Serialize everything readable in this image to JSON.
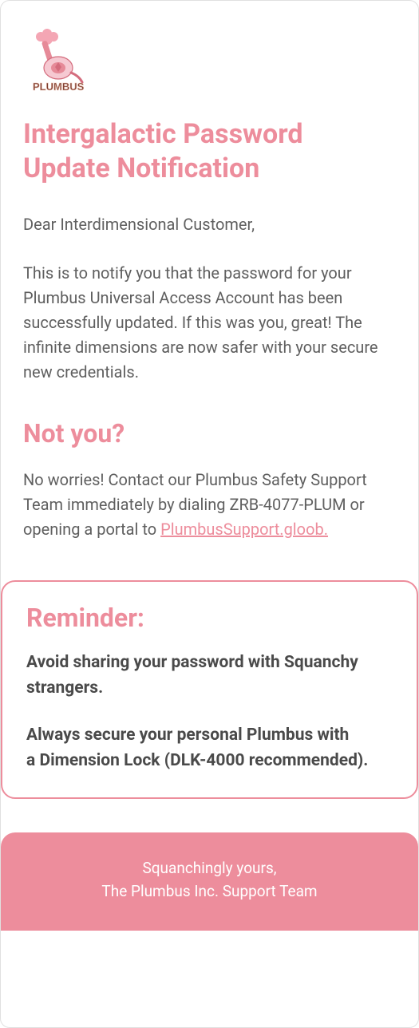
{
  "logo": {
    "text": "PLUMBUS"
  },
  "title": "Intergalactic Password Update Notification",
  "greeting": "Dear Interdimensional Customer,",
  "intro": "This is to notify you that the password for your Plumbus Universal Access Account has been successfully updated. If this was you, great! The infinite dimensions are now safer with your secure new credentials.",
  "not_you": {
    "heading": "Not you?",
    "text_before": "No worries! Contact our Plumbus Safety Support Team immediately by dialing ZRB-4077-PLUM or opening a portal to ",
    "link_text": "PlumbusSupport.gloob."
  },
  "reminder": {
    "heading": "Reminder:",
    "line1": "Avoid sharing your password with Squanchy strangers.",
    "line2a": "Always secure your personal Plumbus with",
    "line2b": "a Dimension Lock (DLK-4000 recommended)."
  },
  "footer": {
    "line1": "Squanchingly yours,",
    "line2": "The Plumbus Inc. Support Team"
  }
}
